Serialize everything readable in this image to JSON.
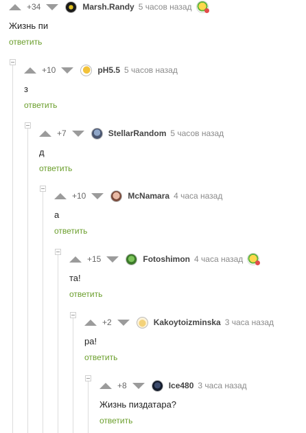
{
  "colors": {
    "link": "#6a9e2b",
    "arrow": "#9b9b9b",
    "thread": "#dcdcdc"
  },
  "comments": [
    {
      "rating": "+34",
      "author": "Marsh.Randy",
      "time": "5 часов назад",
      "text": "Жизнь пи",
      "reply": "ответить",
      "has_award": true
    },
    {
      "rating": "+10",
      "author": "pH5.5",
      "time": "5 часов назад",
      "text": "з",
      "reply": "ответить",
      "has_award": false
    },
    {
      "rating": "+7",
      "author": "StellarRandom",
      "time": "5 часов назад",
      "text": "д",
      "reply": "ответить",
      "has_award": false
    },
    {
      "rating": "+10",
      "author": "McNamara",
      "time": "4 часа назад",
      "text": "а",
      "reply": "ответить",
      "has_award": false
    },
    {
      "rating": "+15",
      "author": "Fotoshimon",
      "time": "4 часа назад",
      "text": "та!",
      "reply": "ответить",
      "has_award": true
    },
    {
      "rating": "+2",
      "author": "Kakoytoizminska",
      "time": "3 часа назад",
      "text": "ра!",
      "reply": "ответить",
      "has_award": false
    },
    {
      "rating": "+8",
      "author": "Ice480",
      "time": "3 часа назад",
      "text": "Жизнь пиздатара?",
      "reply": "ответить",
      "has_award": false
    }
  ]
}
